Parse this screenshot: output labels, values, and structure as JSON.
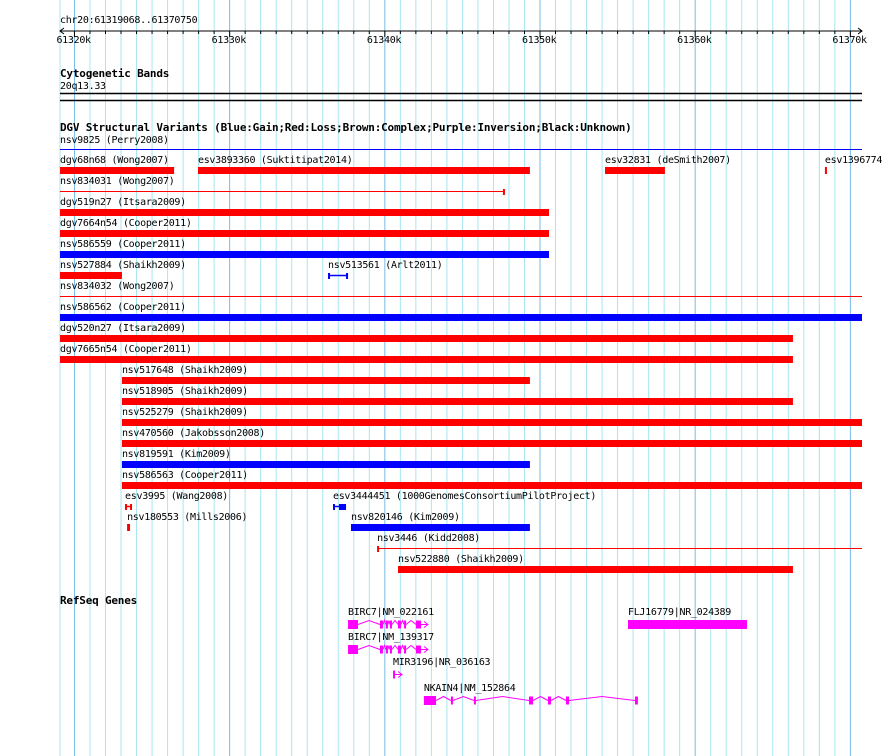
{
  "ruler": {
    "region": "chr20:61319068..61370750",
    "start_kb": 61319.068,
    "end_kb": 61370.75,
    "tick_labels": [
      {
        "kb": 61320,
        "label": "61320k"
      },
      {
        "kb": 61330,
        "label": "61330k"
      },
      {
        "kb": 61340,
        "label": "61340k"
      },
      {
        "kb": 61350,
        "label": "61350k"
      },
      {
        "kb": 61360,
        "label": "61360k"
      },
      {
        "kb": 61370,
        "label": "61370k"
      }
    ]
  },
  "colors": {
    "gain": "#0000ff",
    "loss": "#ff0000",
    "gene": "#ff00ff",
    "grid_minor": "#a8e6f0",
    "grid_major": "#78bde6"
  },
  "cytoband": {
    "title": "Cytogenetic Bands",
    "band": "20q13.33"
  },
  "dgv": {
    "title": "DGV Structural Variants (Blue:Gain;Red:Loss;Brown:Complex;Purple:Inversion;Black:Unknown)",
    "header_variant": {
      "label": "nsv9825 (Perry2008)",
      "type": "gain",
      "style": "line",
      "start": 61319.07,
      "end": 61370.75
    },
    "rows": [
      [
        {
          "label": "dgv68n68 (Wong2007)",
          "type": "loss",
          "style": "bar",
          "start": 61319.07,
          "end": 61326.42
        },
        {
          "label": "esv3893360 (Suktitipat2014)",
          "type": "loss",
          "style": "bar",
          "start": 61327.96,
          "end": 61349.35
        },
        {
          "label": "esv32831 (deSmith2007)",
          "type": "loss",
          "style": "bar",
          "start": 61354.19,
          "end": 61358.05
        },
        {
          "label": "esv1396774",
          "type": "loss",
          "style": "bar",
          "start": 61368.36,
          "end": 61368.49
        }
      ],
      [
        {
          "label": "nsv834031 (Wong2007)",
          "type": "loss",
          "style": "line-end",
          "start": 61319.07,
          "end": 61347.74
        }
      ],
      [
        {
          "label": "dgv519n27 (Itsara2009)",
          "type": "loss",
          "style": "bar",
          "start": 61319.07,
          "end": 61350.58
        }
      ],
      [
        {
          "label": "dgv7664n54 (Cooper2011)",
          "type": "loss",
          "style": "bar",
          "start": 61319.07,
          "end": 61350.58
        }
      ],
      [
        {
          "label": "nsv586559 (Cooper2011)",
          "type": "gain",
          "style": "bar",
          "start": 61319.07,
          "end": 61350.58
        }
      ],
      [
        {
          "label": "nsv527884 (Shaikh2009)",
          "type": "loss",
          "style": "bar",
          "start": 61319.07,
          "end": 61323.06
        },
        {
          "label": "nsv513561 (Arlt2011)",
          "type": "gain",
          "style": "dumbbell",
          "start": 61336.34,
          "end": 61337.63
        }
      ],
      [
        {
          "label": "nsv834032 (Wong2007)",
          "type": "loss",
          "style": "line",
          "start": 61319.07,
          "end": 61370.75
        }
      ],
      [
        {
          "label": "nsv586562 (Cooper2011)",
          "type": "gain",
          "style": "bar",
          "start": 61319.07,
          "end": 61370.75
        }
      ],
      [
        {
          "label": "dgv520n27 (Itsara2009)",
          "type": "loss",
          "style": "bar",
          "start": 61319.07,
          "end": 61366.3
        }
      ],
      [
        {
          "label": "dgv7665n54 (Cooper2011)",
          "type": "loss",
          "style": "bar",
          "start": 61319.07,
          "end": 61366.3
        }
      ],
      [
        {
          "label": "nsv517648 (Shaikh2009)",
          "type": "loss",
          "style": "bar",
          "start": 61323.06,
          "end": 61349.35
        }
      ],
      [
        {
          "label": "nsv518905 (Shaikh2009)",
          "type": "loss",
          "style": "bar",
          "start": 61323.06,
          "end": 61366.3
        }
      ],
      [
        {
          "label": "nsv525279 (Shaikh2009)",
          "type": "loss",
          "style": "bar",
          "start": 61323.06,
          "end": 61370.75
        }
      ],
      [
        {
          "label": "nsv470560 (Jakobsson2008)",
          "type": "loss",
          "style": "bar",
          "start": 61323.06,
          "end": 61370.75
        }
      ],
      [
        {
          "label": "nsv819591 (Kim2009)",
          "type": "gain",
          "style": "bar",
          "start": 61323.06,
          "end": 61349.35
        }
      ],
      [
        {
          "label": "nsv586563 (Cooper2011)",
          "type": "loss",
          "style": "bar",
          "start": 61323.06,
          "end": 61370.75
        }
      ],
      [
        {
          "label": "esv3995 (Wang2008)",
          "type": "loss",
          "style": "dumbbell",
          "start": 61323.26,
          "end": 61323.71
        },
        {
          "label": "esv3444451 (1000GenomesConsortiumPilotProject)",
          "type": "gain",
          "style": "dumbbell-block",
          "start": 61336.66,
          "end": 61337.5
        }
      ],
      [
        {
          "label": "nsv180553 (Mills2006)",
          "type": "loss",
          "style": "bar",
          "start": 61323.39,
          "end": 61323.58
        },
        {
          "label": "nsv820146 (Kim2009)",
          "type": "gain",
          "style": "bar",
          "start": 61337.82,
          "end": 61349.35
        }
      ],
      [
        {
          "label": "nsv3446 (Kidd2008)",
          "type": "loss",
          "style": "line-start",
          "start": 61339.5,
          "end": 61370.75
        }
      ],
      [
        {
          "label": "nsv522880 (Shaikh2009)",
          "type": "loss",
          "style": "bar",
          "start": 61340.85,
          "end": 61366.3
        }
      ]
    ]
  },
  "refseq": {
    "title": "RefSeq Genes",
    "genes": [
      {
        "label": "BIRC7|NM_022161",
        "lane": 0,
        "start": 61337.63,
        "end": 61342.78,
        "strand": "+",
        "exons": [
          [
            61337.63,
            61338.27
          ],
          [
            61339.69,
            61339.88
          ],
          [
            61340.07,
            61340.2
          ],
          [
            61340.33,
            61340.46
          ],
          [
            61340.85,
            61341.04
          ],
          [
            61341.24,
            61341.37
          ],
          [
            61342.01,
            61342.33
          ]
        ]
      },
      {
        "label": "FLJ16779|NR_024389",
        "lane": 0,
        "start": 61355.67,
        "end": 61363.34,
        "strand": "",
        "exons": [
          [
            61355.67,
            61363.34
          ]
        ]
      },
      {
        "label": "BIRC7|NM_139317",
        "lane": 1,
        "start": 61337.63,
        "end": 61342.78,
        "strand": "+",
        "exons": [
          [
            61337.63,
            61338.27
          ],
          [
            61339.69,
            61339.88
          ],
          [
            61340.07,
            61340.2
          ],
          [
            61340.33,
            61340.46
          ],
          [
            61340.85,
            61341.04
          ],
          [
            61341.24,
            61341.37
          ],
          [
            61342.01,
            61342.33
          ]
        ]
      },
      {
        "label": "MIR3196|NR_036163",
        "lane": 2,
        "start": 61340.53,
        "end": 61341.11,
        "strand": "+",
        "exons": [
          [
            61340.53,
            61340.62
          ]
        ]
      },
      {
        "label": "NKAIN4|NM_152864",
        "lane": 3,
        "start": 61342.52,
        "end": 61356.31,
        "strand": "",
        "exons": [
          [
            61342.52,
            61343.3
          ],
          [
            61344.26,
            61344.39
          ],
          [
            61345.74,
            61345.87
          ],
          [
            61349.29,
            61349.55
          ],
          [
            61350.51,
            61350.71
          ],
          [
            61351.67,
            61351.87
          ],
          [
            61356.12,
            61356.31
          ]
        ]
      }
    ]
  }
}
